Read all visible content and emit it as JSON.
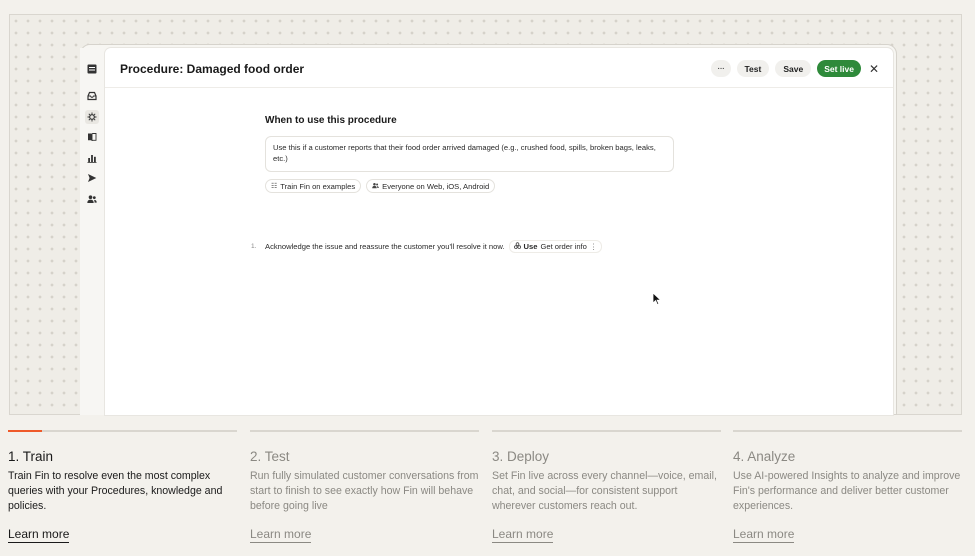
{
  "colors": {
    "accent": "#ef5a2a",
    "live": "#2e8a3a",
    "page_bg": "#f3f1ec"
  },
  "app": {
    "rail_icons": [
      "table-icon",
      "inbox-icon",
      "fin-ai-icon",
      "book-icon",
      "chart-icon",
      "send-icon",
      "people-icon"
    ],
    "active_rail_icon": "fin-ai-icon"
  },
  "procedure": {
    "title": "Procedure: Damaged food order",
    "actions": {
      "more": "···",
      "test": "Test",
      "save": "Save",
      "set_live": "Set live",
      "close": "✕"
    },
    "when_heading": "When to use this procedure",
    "when_text": "Use this if a customer reports that their food order arrived damaged (e.g., crushed food, spills, broken bags, leaks, etc.)",
    "chips": [
      {
        "icon": "list-icon",
        "label": "Train Fin on examples"
      },
      {
        "icon": "people-icon",
        "label": "Everyone on Web, iOS, Android"
      }
    ],
    "steps": [
      {
        "number": "1.",
        "text": "Acknowledge the issue and reassure the customer you'll resolve it now.",
        "tool_verb": "Use",
        "tool_name": "Get order info",
        "tool_more": "⋮"
      }
    ]
  },
  "features": [
    {
      "number_title": "1. Train",
      "text": "Train Fin to resolve even the most complex queries with your Procedures, knowledge and policies.",
      "link": "Learn more",
      "active": true,
      "progress": 0.15
    },
    {
      "number_title": "2. Test",
      "text": "Run fully simulated customer conversations from start to finish to see exactly how Fin will behave before going live",
      "link": "Learn more",
      "active": false,
      "progress": 0
    },
    {
      "number_title": "3. Deploy",
      "text": "Set Fin live across every channel—voice, email, chat, and social—for consistent support wherever customers reach out.",
      "link": "Learn more",
      "active": false,
      "progress": 0
    },
    {
      "number_title": "4. Analyze",
      "text": "Use AI-powered Insights to analyze and improve Fin's performance and deliver better customer experiences.",
      "link": "Learn more",
      "active": false,
      "progress": 0
    }
  ]
}
